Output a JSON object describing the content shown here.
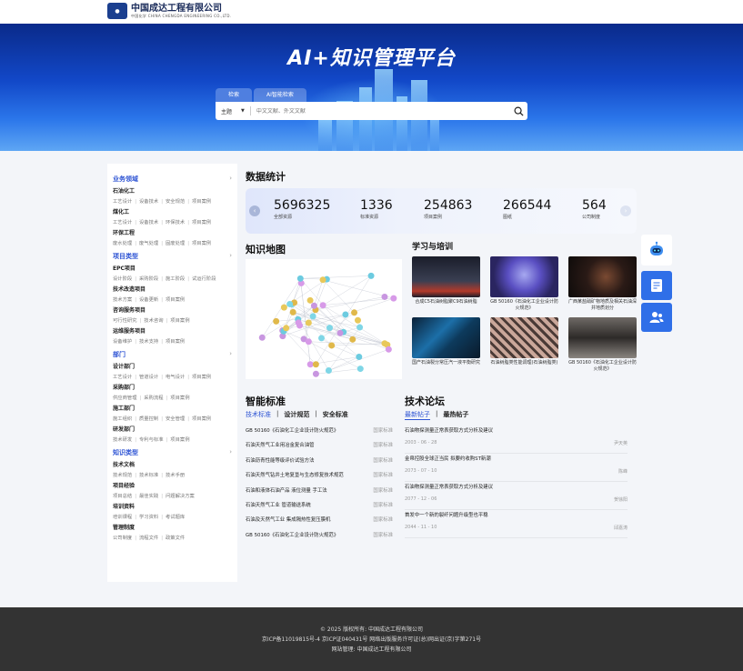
{
  "header": {
    "logo_cn": "中国成达工程有限公司",
    "logo_sub": "中国化学",
    "logo_en": "CHINA CHENGDA ENGINEERING CO.,LTD."
  },
  "hero": {
    "title": "AI+知识管理平台",
    "tabs": [
      "检索",
      "AI智能检索"
    ],
    "search": {
      "select_value": "主题",
      "placeholder": "中文文献、外文文献"
    }
  },
  "sidebar": {
    "sections": [
      {
        "title": "业务领域",
        "groups": [
          {
            "name": "石油化工",
            "links": [
              "工艺设计",
              "设备技术",
              "安全规范",
              "项目案例"
            ]
          },
          {
            "name": "煤化工",
            "links": [
              "工艺设计",
              "设备技术",
              "环保技术",
              "项目案例"
            ]
          },
          {
            "name": "环保工程",
            "links": [
              "废水处理",
              "废气处理",
              "固废处理",
              "项目案例"
            ]
          }
        ]
      },
      {
        "title": "项目类型",
        "groups": [
          {
            "name": "EPC项目",
            "links": [
              "设计阶段",
              "采购阶段",
              "施工阶段",
              "试运行阶段"
            ]
          },
          {
            "name": "技术改造项目",
            "links": [
              "技术方案",
              "设备更新",
              "项目案例"
            ]
          },
          {
            "name": "咨询服务项目",
            "links": [
              "可行性研究",
              "技术咨询",
              "项目案例"
            ]
          },
          {
            "name": "运维服务项目",
            "links": [
              "设备维护",
              "技术支持",
              "项目案例"
            ]
          }
        ]
      },
      {
        "title": "部门",
        "groups": [
          {
            "name": "设计部门",
            "links": [
              "工艺设计",
              "管道设计",
              "电气设计",
              "项目案例"
            ]
          },
          {
            "name": "采购部门",
            "links": [
              "供应商管理",
              "采购流程",
              "项目案例"
            ]
          },
          {
            "name": "施工部门",
            "links": [
              "施工组织",
              "质量控制",
              "安全管理",
              "项目案例"
            ]
          },
          {
            "name": "研发部门",
            "links": [
              "技术研发",
              "专利与标准",
              "项目案例"
            ]
          }
        ]
      },
      {
        "title": "知识类型",
        "groups": [
          {
            "name": "技术文档",
            "links": [
              "技术规范",
              "技术标准",
              "技术手册"
            ]
          },
          {
            "name": "项目经验",
            "links": [
              "项目总结",
              "最佳实践",
              "问题解决方案"
            ]
          },
          {
            "name": "培训资料",
            "links": [
              "培训课程",
              "学习资料",
              "考试题库"
            ]
          },
          {
            "name": "管理制度",
            "links": [
              "公司制度",
              "流程文件",
              "政策文件"
            ]
          }
        ]
      }
    ]
  },
  "stats": {
    "title": "数据统计",
    "items": [
      {
        "num": "5696325",
        "label": "全部资源"
      },
      {
        "num": "1336",
        "label": "标准资源"
      },
      {
        "num": "254863",
        "label": "项目案例"
      },
      {
        "num": "266544",
        "label": "图纸"
      },
      {
        "num": "564",
        "label": "公司制度"
      }
    ]
  },
  "knowledge_map": {
    "title": "知识地图"
  },
  "learning": {
    "title": "学习与培训",
    "cards": [
      "合成C5石油树脂聚C9石油树脂",
      "GB 50160《石油化工企业设计防火规范》",
      "广西某盐硝矿物地质及相关石油深井地质划分",
      "国产石油裂分常压汽一液平衡研究",
      "石油树脂类性能调理(石油树脂类)",
      "GB 50160《石油化工企业设计防火规范》"
    ]
  },
  "standards": {
    "title": "智能标准",
    "tabs": [
      "技术标准",
      "设计规范",
      "安全标准"
    ],
    "rows": [
      {
        "name": "GB 50160《石油化工企业设计防火规范》",
        "tag": "国家标准"
      },
      {
        "name": "石油天然气工业用冶金复合油管",
        "tag": "国家标准"
      },
      {
        "name": "石油沥青性能等级评价试验方法",
        "tag": "国家标准"
      },
      {
        "name": "石油天然气钻井土地复垦与生态修复技术规范",
        "tag": "国家标准"
      },
      {
        "name": "石油和液体石油产品  液位测量  手工法",
        "tag": "国家标准"
      },
      {
        "name": "石油天然气工业  管道输送系统",
        "tag": "国家标准"
      },
      {
        "name": "石油及天然气工业  集成隔热性复压膜机",
        "tag": "国家标准"
      },
      {
        "name": "GB 50160《石油化工企业设计防火规范》",
        "tag": "国家标准"
      }
    ]
  },
  "forum": {
    "title": "技术论坛",
    "tabs": [
      "最新帖子",
      "最热帖子"
    ],
    "posts": [
      {
        "title": "石油物探测量正常表获取方式分析及建议",
        "date": "2003 - 06 - 28",
        "author": "尹天英"
      },
      {
        "title": "金帛控股全球正当民 拟要约收购ST新潮",
        "date": "2073 - 07 - 10",
        "author": "陈峰"
      },
      {
        "title": "石油物探测量正常表获取方式分析及建议",
        "date": "2077 - 12 - 06",
        "author": "贺徐阳"
      },
      {
        "title": "首发中一个新的裂纤问题升级型也平稳",
        "date": "2044 - 11 - 10",
        "author": "邱嘉涛"
      }
    ]
  },
  "footer": {
    "line1": "© 2025 版权所有: 中国成达工程有限公司",
    "line2": "京ICP备11019815号-4  京ICP证040431号  网络出版服务许可证(总)网出证(京)字第271号",
    "line3": "网站管理: 中国成达工程有限公司"
  },
  "colors": {
    "accent": "#2f55d4",
    "hero_dark": "#0a2a8a",
    "footer_bg": "#333333"
  }
}
